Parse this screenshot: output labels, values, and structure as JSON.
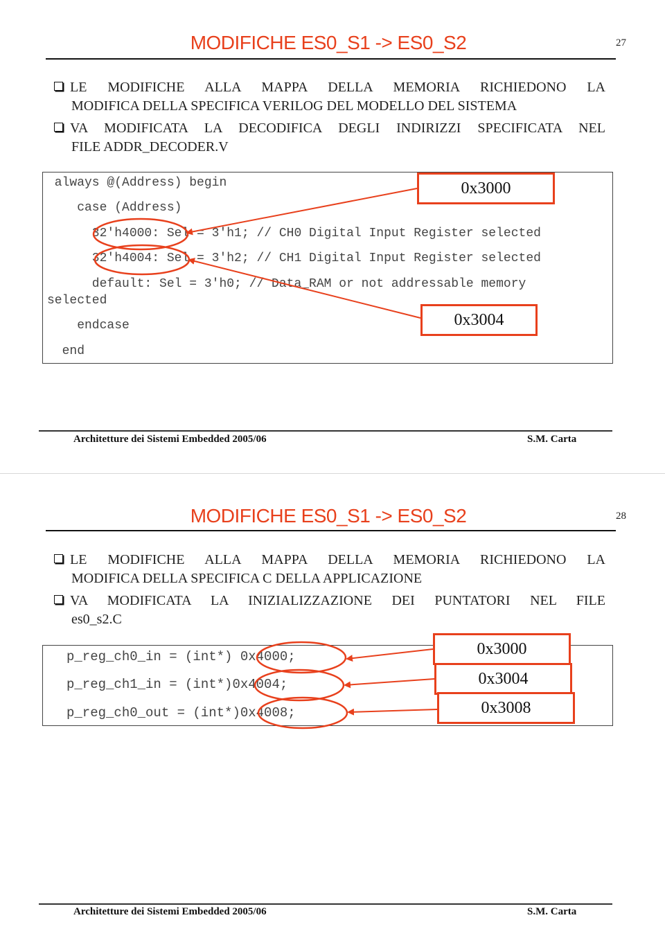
{
  "slides": [
    {
      "title": "MODIFICHE ES0_S1 -> ES0_S2",
      "page_number": "27",
      "bullets": [
        {
          "line1": "LE MODIFICHE ALLA MAPPA DELLA MEMORIA RICHIEDONO LA",
          "line2": "MODIFICA DELLA SPECIFICA VERILOG DEL MODELLO DEL SISTEMA"
        },
        {
          "line1": "VA MODIFICATA LA DECODIFICA DEGLI INDIRIZZI SPECIFICATA NEL",
          "line2": "FILE ADDR_DECODER.V"
        }
      ],
      "code_lines": [
        " always @(Address) begin",
        "    case (Address)",
        "      32'h4000: Sel = 3'h1; // CH0 Digital Input Register selected",
        "      32'h4004: Sel = 3'h2; // CH1 Digital Input Register selected",
        "      default: Sel = 3'h0; // Data_RAM or not addressable memory",
        "selected",
        "    endcase",
        "  end"
      ],
      "callouts": [
        "0x3000",
        "0x3004"
      ],
      "footer_left": "Architetture dei Sistemi Embedded 2005/06",
      "footer_right": "S.M. Carta"
    },
    {
      "title": "MODIFICHE ES0_S1 -> ES0_S2",
      "page_number": "28",
      "bullets": [
        {
          "line1": "LE MODIFICHE ALLA MAPPA DELLA MEMORIA RICHIEDONO LA",
          "line2": "MODIFICA DELLA SPECIFICA C DELLA APPLICAZIONE"
        },
        {
          "line1": "VA MODIFICATA LA INIZIALIZZAZIONE DEI PUNTATORI NEL FILE",
          "line2": "es0_s2.C"
        }
      ],
      "code_lines": [
        "p_reg_ch0_in = (int*) 0x4000;",
        "p_reg_ch1_in = (int*)0x4004;",
        "p_reg_ch0_out = (int*)0x4008;"
      ],
      "callouts": [
        "0x3000",
        "0x3004",
        "0x3008"
      ],
      "footer_left": "Architetture dei Sistemi Embedded 2005/06",
      "footer_right": "S.M. Carta"
    }
  ],
  "colors": {
    "accent": "#e8401c",
    "text": "#222222",
    "code": "#444444"
  }
}
